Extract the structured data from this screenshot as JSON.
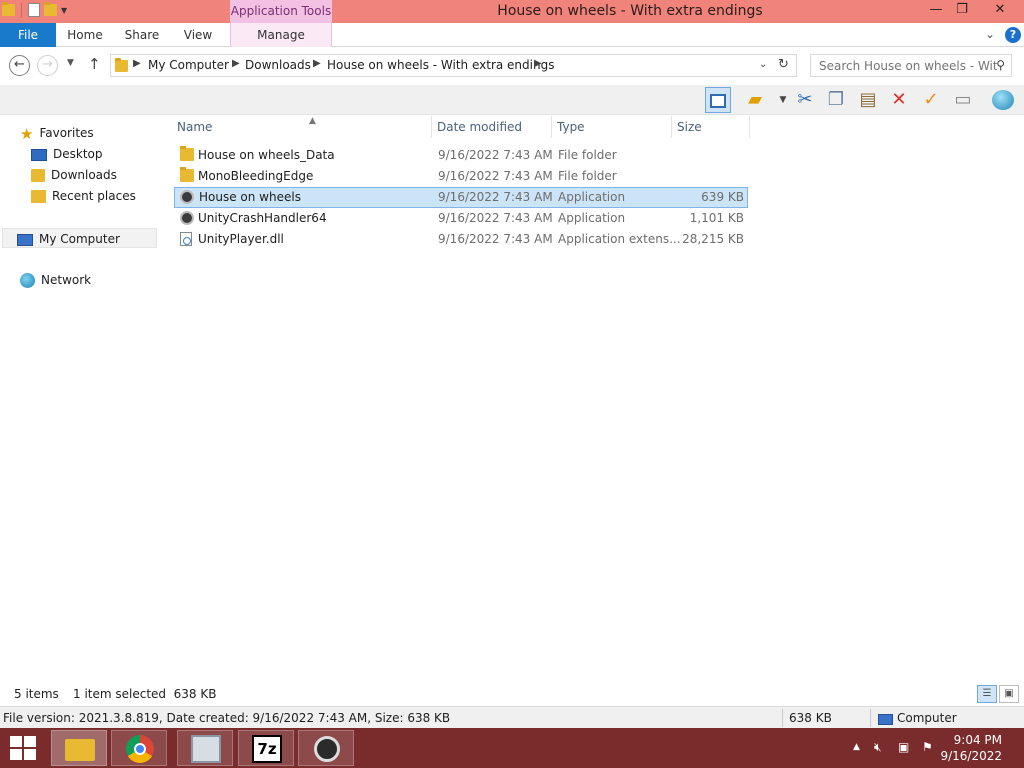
{
  "window": {
    "title": "House on wheels - With extra endings",
    "context_tab": "Application Tools",
    "minimize": "—",
    "maximize": "❐",
    "close": "✕"
  },
  "ribbon": {
    "tabs": [
      {
        "label": "File"
      },
      {
        "label": "Home"
      },
      {
        "label": "Share"
      },
      {
        "label": "View"
      },
      {
        "label": "Manage"
      }
    ],
    "expand_glyph": "⌄",
    "help": "?"
  },
  "address": {
    "crumbs": [
      "My Computer",
      "Downloads",
      "House on wheels - With extra endings"
    ],
    "search_placeholder": "Search House on wheels - Wit..."
  },
  "nav": {
    "favorites": "Favorites",
    "items": [
      {
        "label": "Desktop"
      },
      {
        "label": "Downloads"
      },
      {
        "label": "Recent places"
      }
    ],
    "my_computer": "My Computer",
    "network": "Network"
  },
  "columns": {
    "name": "Name",
    "date": "Date modified",
    "type": "Type",
    "size": "Size"
  },
  "files": [
    {
      "name": "House on wheels_Data",
      "date": "9/16/2022 7:43 AM",
      "type": "File folder",
      "size": ""
    },
    {
      "name": "MonoBleedingEdge",
      "date": "9/16/2022 7:43 AM",
      "type": "File folder",
      "size": ""
    },
    {
      "name": "House on wheels",
      "date": "9/16/2022 7:43 AM",
      "type": "Application",
      "size": "639 KB"
    },
    {
      "name": "UnityCrashHandler64",
      "date": "9/16/2022 7:43 AM",
      "type": "Application",
      "size": "1,101 KB"
    },
    {
      "name": "UnityPlayer.dll",
      "date": "9/16/2022 7:43 AM",
      "type": "Application extens...",
      "size": "28,215 KB"
    }
  ],
  "status": {
    "items_count": "5 items",
    "selected": "1 item selected  638 KB",
    "details": "File version: 2021.3.8.819, Date created: 9/16/2022 7:43 AM, Size: 638 KB",
    "size": "638 KB",
    "location": "Computer"
  },
  "taskbar": {
    "time": "9:04 PM",
    "date": "9/16/2022",
    "seven_zip": "7z"
  },
  "colors": {
    "titlebar": "#f0837a",
    "file_tab": "#1979ca",
    "taskbar": "#7a2b2c",
    "selection": "#cce4f7"
  }
}
